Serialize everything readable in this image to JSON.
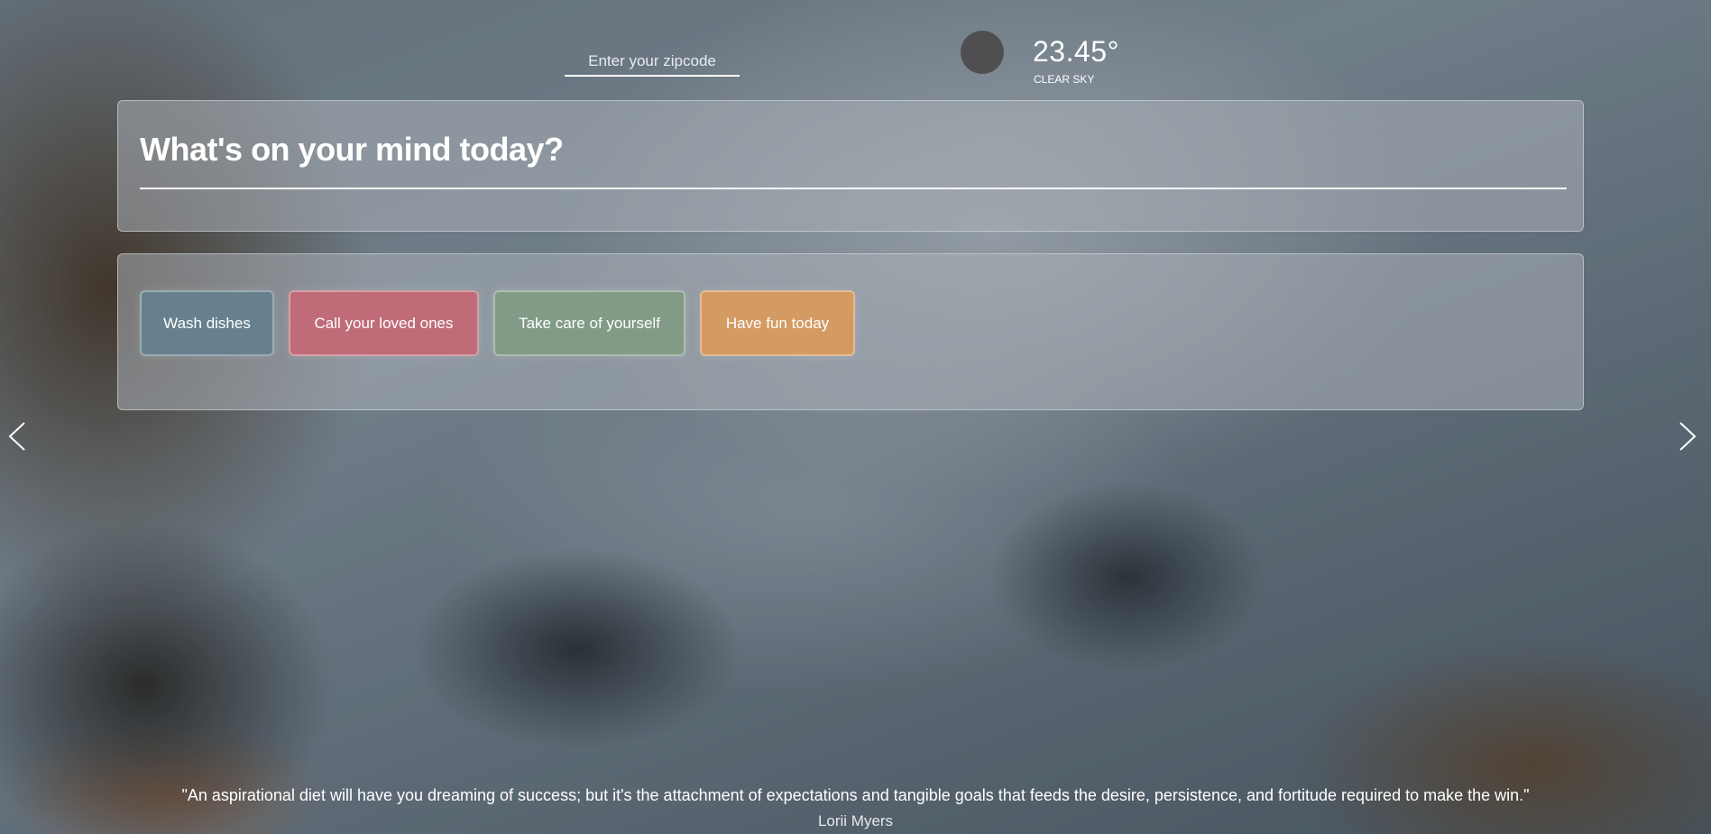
{
  "zipcode": {
    "placeholder": "Enter your zipcode",
    "value": ""
  },
  "weather": {
    "icon": "weather-icon",
    "temperature": "23.45°",
    "condition": "CLEAR SKY"
  },
  "mind": {
    "placeholder": "What's on your mind today?",
    "value": ""
  },
  "tasks": [
    {
      "label": "Wash dishes",
      "color": "#66808e"
    },
    {
      "label": "Call your loved ones",
      "color": "#c06c78"
    },
    {
      "label": "Take care of yourself",
      "color": "#819b87"
    },
    {
      "label": "Have fun today",
      "color": "#d39a62"
    }
  ],
  "nav": {
    "prev_icon": "chevron-left-icon",
    "next_icon": "chevron-right-icon"
  },
  "quote": {
    "text": "\"An aspirational diet will have you dreaming of success; but it's the attachment of expectations and tangible goals that feeds the desire, persistence, and fortitude required to make the win.\"",
    "author": "Lorii Myers"
  }
}
